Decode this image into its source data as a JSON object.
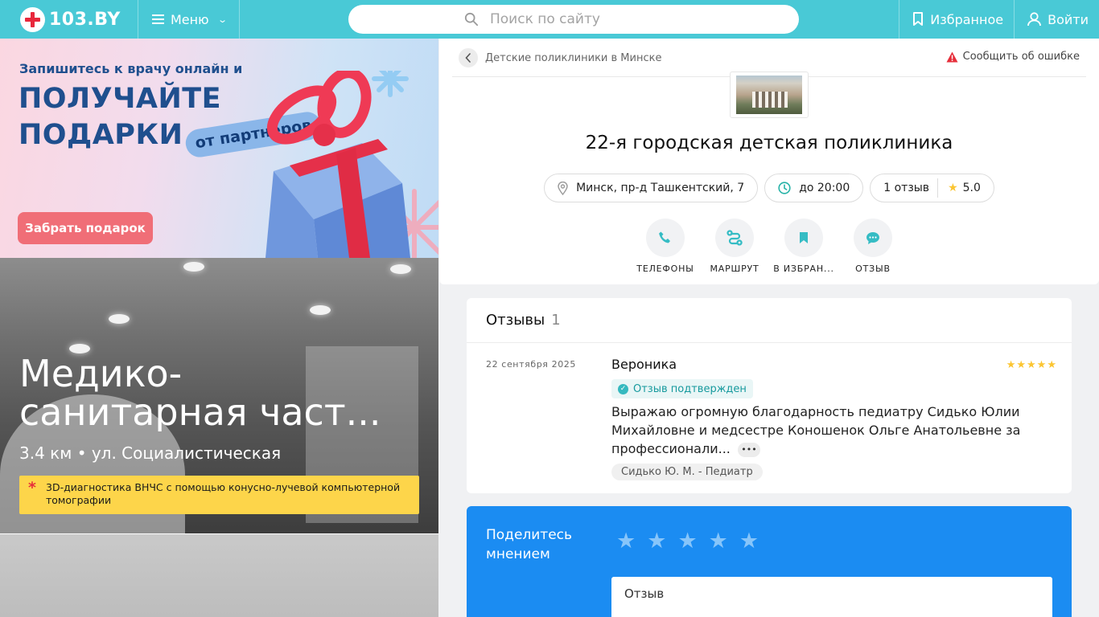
{
  "header": {
    "logo_text": "103.BY",
    "menu_label": "Меню",
    "search_placeholder": "Поиск по сайту",
    "favorites_label": "Избранное",
    "login_label": "Войти"
  },
  "promo_banner": {
    "line1": "Запишитесь к врачу онлайн и",
    "line2": "ПОЛУЧАЙТЕ",
    "line3": "ПОДАРКИ",
    "pill": "от партнеров",
    "button": "Забрать подарок"
  },
  "clinic_banner": {
    "title_line1": "Медико-",
    "title_line2": "санитарная част...",
    "address": "3.4 км • ул. Социалистическая",
    "note": "3D-диагностика ВНЧС с помощью конусно-лучевой компьютерной томографии"
  },
  "breadcrumb": {
    "label": "Детские поликлиники в Минске"
  },
  "report_error": "Сообщить об ошибке",
  "clinic": {
    "name": "22-я городская детская поликлиника",
    "address": "Минск, пр-д Ташкентский, 7",
    "hours": "до 20:00",
    "reviews_count": "1 отзыв",
    "rating": "5.0"
  },
  "actions": [
    {
      "label": "ТЕЛЕФОНЫ",
      "icon": "phone-icon"
    },
    {
      "label": "МАРШРУТ",
      "icon": "route-icon"
    },
    {
      "label": "В ИЗБРАН...",
      "icon": "bookmark-icon"
    },
    {
      "label": "ОТЗЫВ",
      "icon": "chat-bubble-icon"
    }
  ],
  "reviews": {
    "title": "Отзывы",
    "count": "1",
    "items": [
      {
        "date": "22 сентября 2025",
        "author": "Вероника",
        "stars": "★★★★★",
        "verified": "Отзыв подтвержден",
        "text": "Выражаю огромную благодарность  педиатру Сидько Юлии Михайловне и медсестре Коношенок Ольге Анатольевне за профессионали...",
        "more": "•••",
        "tag": "Сидько Ю. М. - Педиатр"
      }
    ]
  },
  "share": {
    "title": "Поделитесь мнением",
    "star": "★",
    "review_placeholder": "Отзыв"
  },
  "colors": {
    "header_bg": "#49c9d6",
    "accent_blue": "#1b8cf2",
    "star_yellow": "#fbc531",
    "note_yellow": "#fdd54a",
    "logo_red": "#e8283c"
  }
}
